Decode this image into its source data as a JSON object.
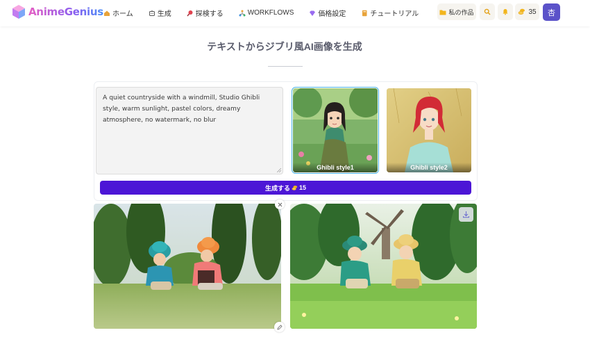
{
  "app": {
    "logo_text": "AnimeGenius"
  },
  "nav": [
    {
      "label": "ホーム",
      "icon": "home-icon"
    },
    {
      "label": "生成",
      "icon": "generate-icon"
    },
    {
      "label": "探検する",
      "icon": "explore-icon"
    },
    {
      "label": "WORKFLOWS",
      "icon": "workflows-icon"
    },
    {
      "label": "価格設定",
      "icon": "pricing-icon"
    },
    {
      "label": "チュートリアル",
      "icon": "tutorial-icon"
    }
  ],
  "header_actions": {
    "my_works_label": "私の作品",
    "coins": "35",
    "avatar_initial": "杏"
  },
  "page": {
    "title": "テキストからジブリ風AI画像を生成"
  },
  "generator": {
    "prompt": "A quiet countryside with a windmill, Studio Ghibli style, warm sunlight, pastel colors, dreamy atmosphere, no watermark, no blur",
    "styles": [
      {
        "label": "Ghibli style1",
        "selected": true
      },
      {
        "label": "Ghibli style2",
        "selected": false
      }
    ],
    "generate_label": "生成する",
    "generate_cost": "15"
  },
  "colors": {
    "accent": "#4c16d6",
    "avatar": "#5b52c9",
    "selected_outline": "#4ab3e6"
  }
}
